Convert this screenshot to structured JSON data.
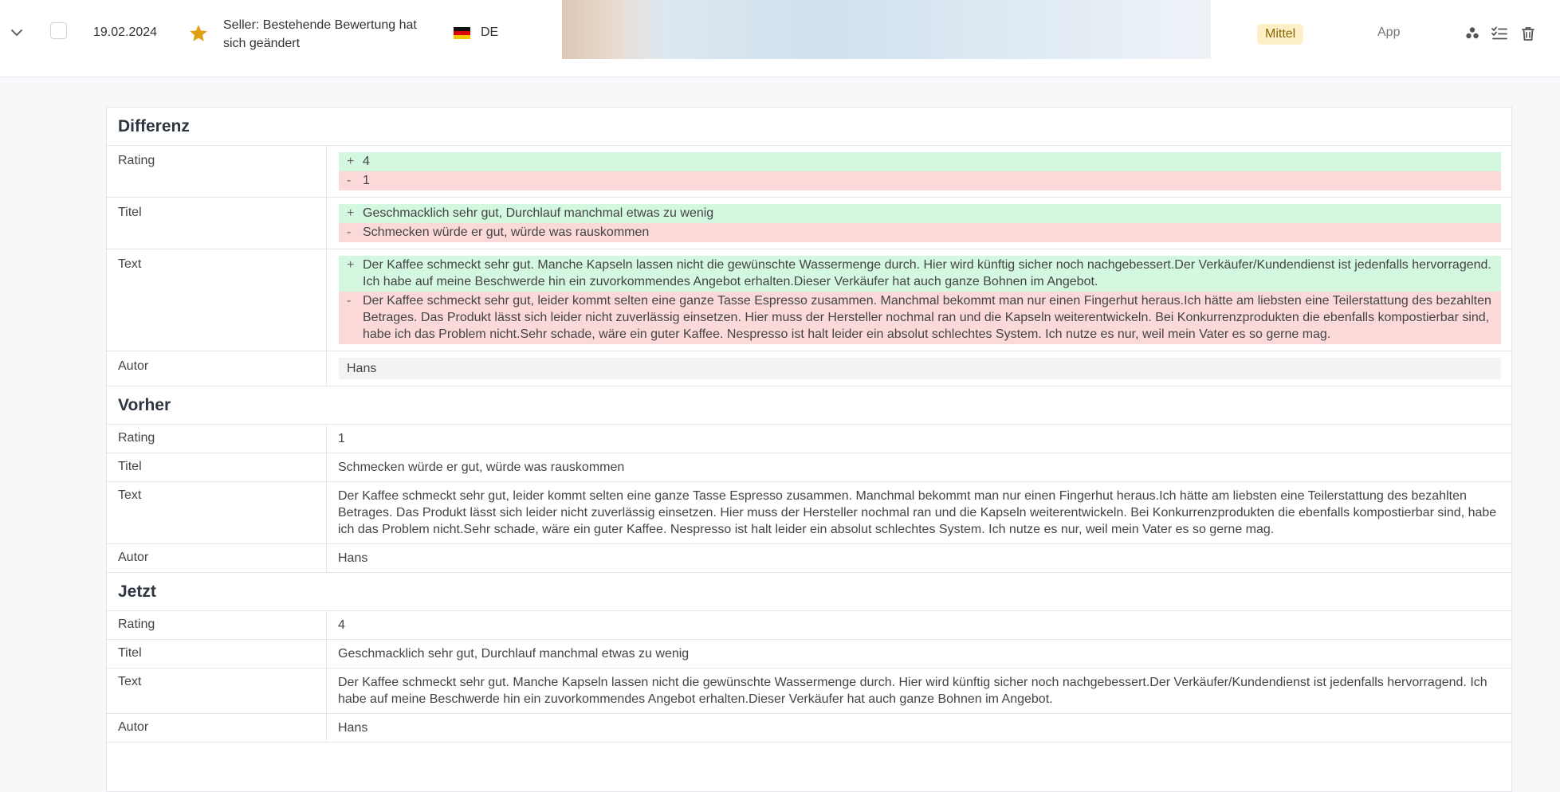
{
  "header": {
    "date": "19.02.2024",
    "subject": "Seller: Bestehende Bewertung hat sich geändert",
    "language": "DE",
    "priority": "Mittel",
    "channel": "App",
    "icons": [
      "chevron-down-icon",
      "checkbox",
      "star-icon",
      "flag-de-icon",
      "group-icon",
      "checklist-icon",
      "trash-icon"
    ],
    "colors": {
      "star": "#e0a013",
      "badge_bg": "#fdefc6",
      "badge_text": "#8a6500"
    }
  },
  "sections": {
    "diff": "Differenz",
    "before": "Vorher",
    "now": "Jetzt"
  },
  "labels": {
    "rating": "Rating",
    "title": "Titel",
    "text": "Text",
    "author": "Autor"
  },
  "diff": {
    "rating_add": "4",
    "rating_del": "1",
    "title_add": "Geschmacklich sehr gut, Durchlauf manchmal etwas zu wenig",
    "title_del": "Schmecken würde er gut, würde was rauskommen",
    "text_add": "Der Kaffee schmeckt sehr gut. Manche Kapseln lassen nicht die gewünschte Wassermenge durch. Hier wird künftig sicher noch nachgebessert.Der Verkäufer/Kundendienst ist jedenfalls hervorragend. Ich habe auf meine Beschwerde hin ein zuvorkommendes Angebot erhalten.Dieser Verkäufer hat auch ganze Bohnen im Angebot.",
    "text_del": "Der Kaffee schmeckt sehr gut, leider kommt selten eine ganze Tasse Espresso zusammen. Manchmal bekommt man nur einen Fingerhut heraus.Ich hätte am liebsten eine Teilerstattung des bezahlten Betrages. Das Produkt lässt sich leider nicht zuverlässig einsetzen. Hier muss der Hersteller nochmal ran und die Kapseln weiterentwickeln. Bei Konkurrenzprodukten die ebenfalls kompostierbar sind, habe ich das Problem nicht.Sehr schade, wäre ein guter Kaffee. Nespresso ist halt leider ein absolut schlechtes System. Ich nutze es nur, weil mein Vater es so gerne mag.",
    "author": "Hans",
    "sign_add": "+",
    "sign_del": "-",
    "colors": {
      "add_bg": "#d4f7e0",
      "del_bg": "#fbd9d9"
    }
  },
  "before": {
    "rating": "1",
    "title": "Schmecken würde er gut, würde was rauskommen",
    "text": "Der Kaffee schmeckt sehr gut, leider kommt selten eine ganze Tasse Espresso zusammen. Manchmal bekommt man nur einen Fingerhut heraus.Ich hätte am liebsten eine Teilerstattung des bezahlten Betrages. Das Produkt lässt sich leider nicht zuverlässig einsetzen. Hier muss der Hersteller nochmal ran und die Kapseln weiterentwickeln. Bei Konkurrenzprodukten die ebenfalls kompostierbar sind, habe ich das Problem nicht.Sehr schade, wäre ein guter Kaffee. Nespresso ist halt leider ein absolut schlechtes System. Ich nutze es nur, weil mein Vater es so gerne mag.",
    "author": "Hans"
  },
  "now": {
    "rating": "4",
    "title": "Geschmacklich sehr gut, Durchlauf manchmal etwas zu wenig",
    "text": "Der Kaffee schmeckt sehr gut. Manche Kapseln lassen nicht die gewünschte Wassermenge durch. Hier wird künftig sicher noch nachgebessert.Der Verkäufer/Kundendienst ist jedenfalls hervorragend. Ich habe auf meine Beschwerde hin ein zuvorkommendes Angebot erhalten.Dieser Verkäufer hat auch ganze Bohnen im Angebot.",
    "author": "Hans"
  }
}
